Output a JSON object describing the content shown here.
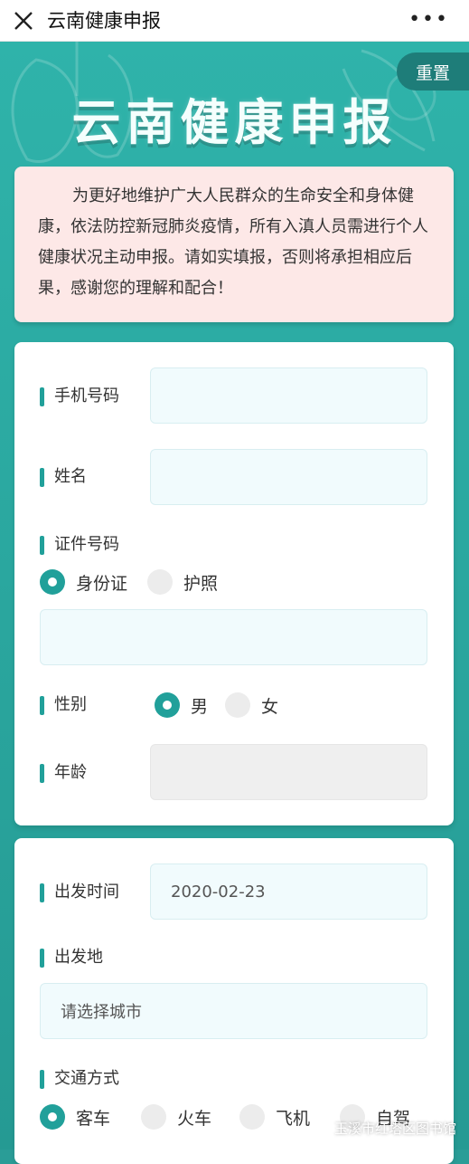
{
  "topbar": {
    "title": "云南健康申报"
  },
  "header": {
    "reset_label": "重置",
    "title": "云南健康申报"
  },
  "notice": {
    "text": "为更好地维护广大人民群众的生命安全和身体健康，依法防控新冠肺炎疫情，所有入滇人员需进行个人健康状况主动申报。请如实填报，否则将承担相应后果，感谢您的理解和配合！"
  },
  "form1": {
    "phone_label": "手机号码",
    "phone_value": "",
    "name_label": "姓名",
    "name_value": "",
    "id_label": "证件号码",
    "id_types": [
      "身份证",
      "护照"
    ],
    "id_selected": "身份证",
    "id_value": "",
    "gender_label": "性别",
    "genders": [
      "男",
      "女"
    ],
    "gender_selected": "男",
    "age_label": "年龄",
    "age_value": ""
  },
  "form2": {
    "depart_time_label": "出发时间",
    "depart_time_value": "2020-02-23",
    "origin_label": "出发地",
    "origin_placeholder": "请选择城市",
    "transport_label": "交通方式",
    "transport_options": [
      "客车",
      "火车",
      "飞机",
      "自驾"
    ],
    "transport_selected": "客车"
  },
  "watermark": {
    "text": "玉溪市红塔区图书馆"
  },
  "colors": {
    "accent": "#21a09a",
    "notice_bg": "#fde8e7",
    "field_bg": "#f1fbfd"
  }
}
